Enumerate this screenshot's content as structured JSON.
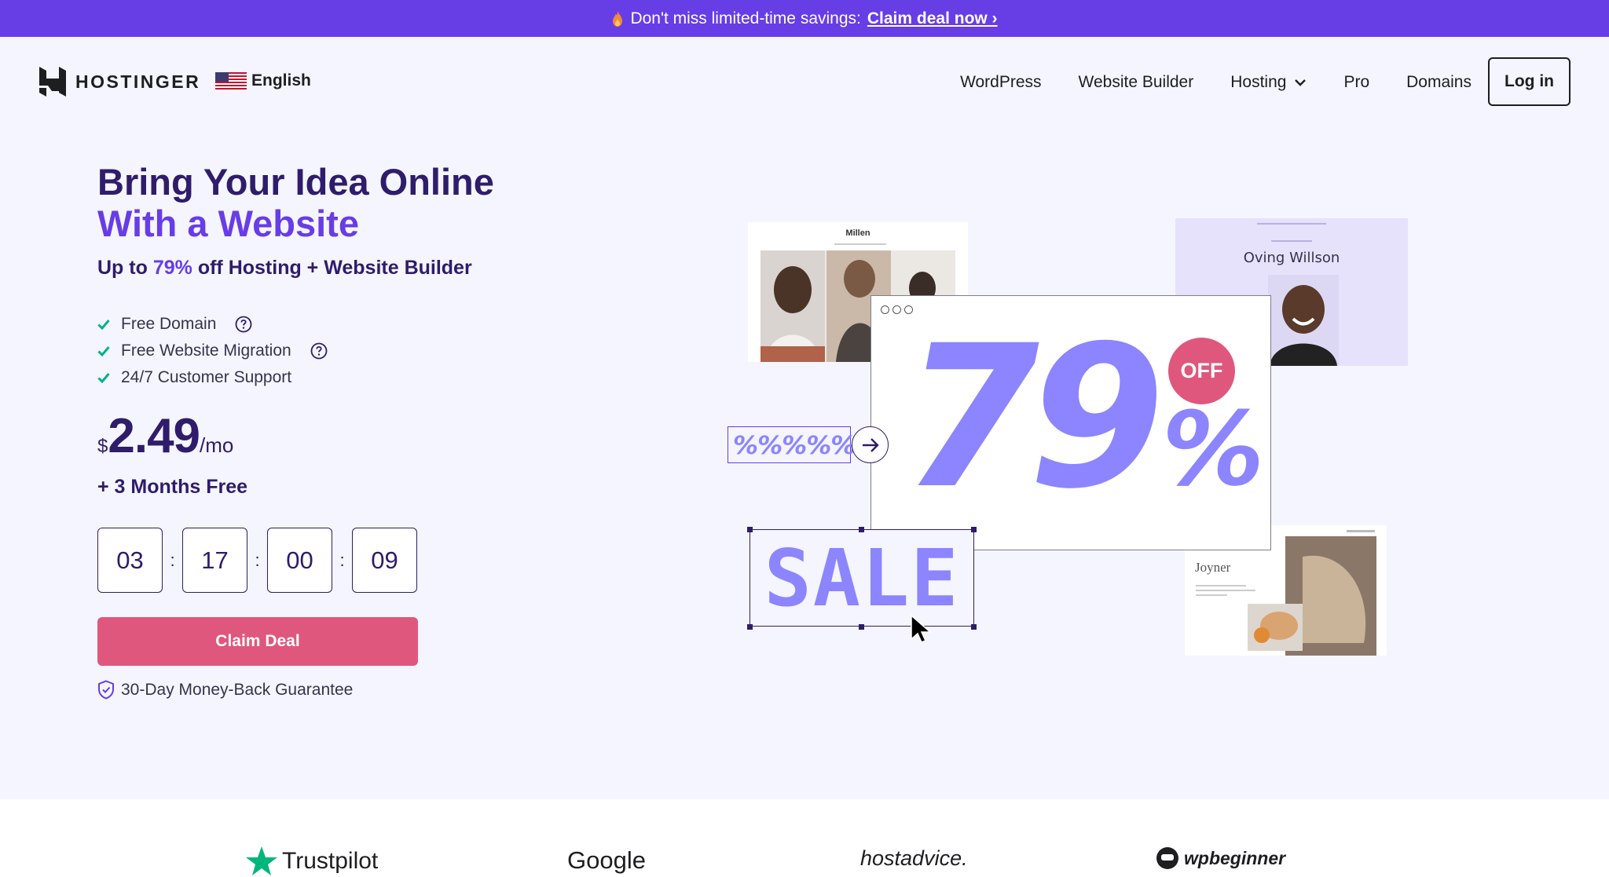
{
  "promo": {
    "text": "Don't miss limited-time savings:",
    "link": "Claim deal now ›"
  },
  "header": {
    "logo_text": "HOSTINGER",
    "language": "English",
    "nav": [
      "WordPress",
      "Website Builder",
      "Hosting",
      "Pro",
      "Domains"
    ],
    "login_label": "Log in"
  },
  "hero": {
    "title_line1": "Bring Your Idea Online",
    "title_line2": "With a Website",
    "subtitle_pre": "Up to ",
    "subtitle_pct": "79%",
    "subtitle_post": " off Hosting + Website Builder",
    "features": [
      "Free Domain",
      "Free Website Migration",
      "24/7 Customer Support"
    ],
    "price_currency": "$",
    "price_amount": "2.49",
    "price_period": "/mo",
    "bonus": "+ 3 Months Free",
    "countdown": [
      "03",
      "17",
      "00",
      "09"
    ],
    "countdown_sep": ":",
    "cta_label": "Claim Deal",
    "guarantee": "30-Day Money-Back Guarantee"
  },
  "visual": {
    "card_millen_title": "Millen",
    "card_oving_title": "Oving Willson",
    "card_joyner_title": "Joyner",
    "big_number": "79",
    "big_percent": "%",
    "off_badge": "OFF",
    "percent_strip": "%%%%%",
    "sale_text": "SALE"
  },
  "trust": {
    "brands": [
      "Trustpilot",
      "Google",
      "hostadvice.",
      "wpbeginner"
    ]
  },
  "colors": {
    "accent": "#673de6",
    "primary_text": "#2f1c6a",
    "cta": "#e0577d",
    "check": "#00b090",
    "visual_purple": "#8c85ff"
  }
}
